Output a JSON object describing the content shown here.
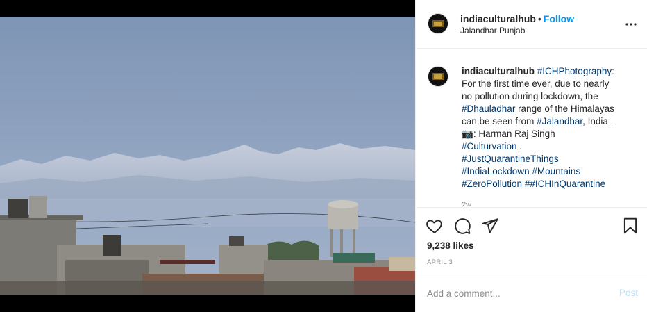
{
  "post": {
    "username": "indiaculturalhub",
    "separator": "•",
    "follow_label": "Follow",
    "location": "Jalandhar Punjab",
    "more_icon": "more-options-icon",
    "caption": {
      "username": "indiaculturalhub",
      "line1_tag": "#ICHPhotography",
      "line1_rest": ":",
      "line2": "For the first time ever, due to nearly",
      "line3": "no pollution during lockdown, the",
      "line4_tag": "#Dhauladhar",
      "line4_rest": " range of the Himalayas",
      "line5_pre": "can be seen from ",
      "line5_tag": "#Jalandhar",
      "line5_rest": ", India .",
      "line6_icon": "📷",
      "line6_text": ": Harman Raj Singh",
      "line7_tag": "#Culturvation",
      "line7_rest": " .",
      "line8_tag": "#JustQuarantineThings",
      "line9_tag1": "#IndiaLockdown",
      "line9_tag2": "#Mountains",
      "line10_tag1": "#ZeroPollution",
      "line10_pre2": " #",
      "line10_tag2": "#ICHInQuarantine"
    },
    "time_ago": "2w",
    "likes": "9,238 likes",
    "date": "APRIL 3",
    "comment_placeholder": "Add a comment...",
    "post_label": "Post",
    "colors": {
      "link": "#00376b",
      "follow": "#0095f6",
      "post_disabled": "#b2dffc",
      "muted": "#8e8e8e"
    },
    "icons": [
      "heart-icon",
      "comment-icon",
      "share-icon",
      "bookmark-icon"
    ]
  }
}
